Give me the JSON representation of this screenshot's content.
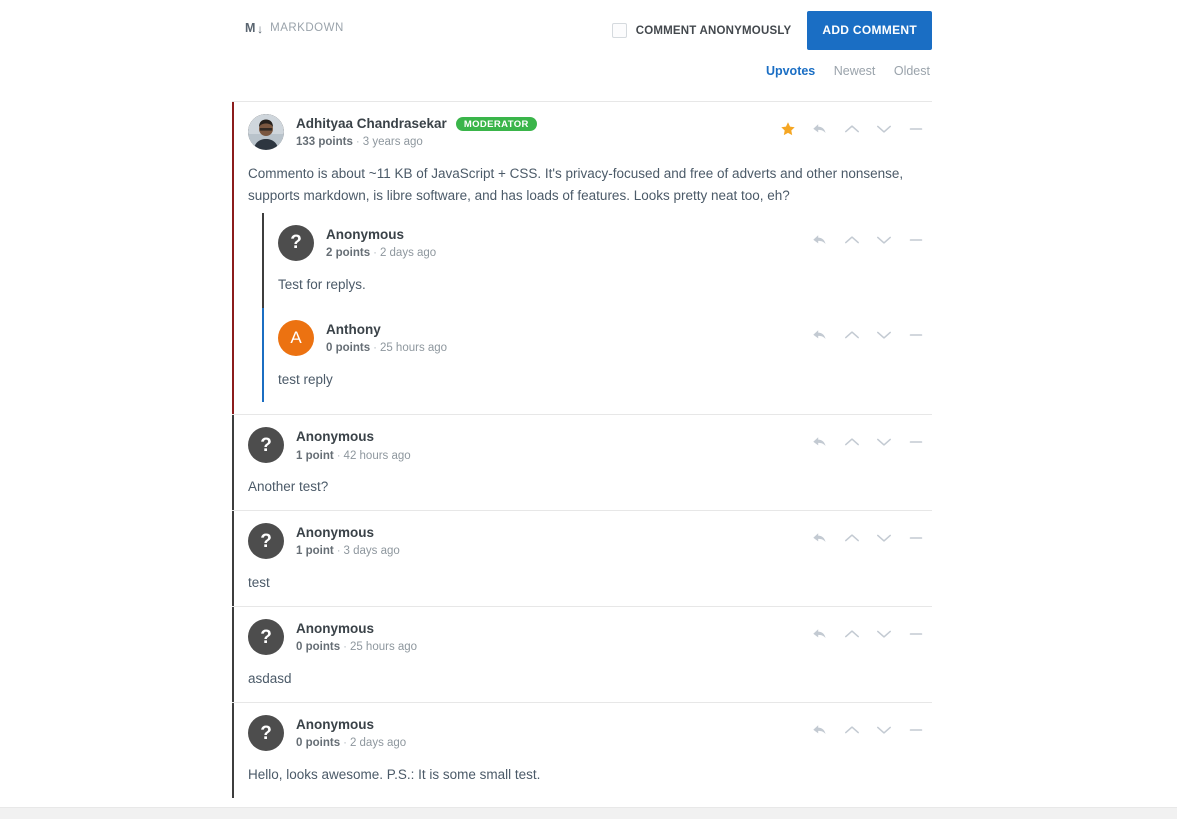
{
  "toolbar": {
    "markdown_glyph": "M",
    "markdown_arrow": "↓",
    "markdown_label": "MARKDOWN",
    "anonymous_label": "COMMENT ANONYMOUSLY",
    "anonymous_checked": false,
    "add_comment_label": "ADD COMMENT",
    "accent_color": "#1a6ec4"
  },
  "sort": {
    "options": [
      {
        "label": "Upvotes",
        "active": true
      },
      {
        "label": "Newest",
        "active": false
      },
      {
        "label": "Oldest",
        "active": false
      }
    ]
  },
  "comments": [
    {
      "author": "Adhityaa Chandrasekar",
      "badge": "MODERATOR",
      "points": "133 points",
      "separator": "·",
      "time": "3 years ago",
      "body": "Commento is about ~11 KB of JavaScript + CSS. It's privacy-focused and free of adverts and other nonsense, supports markdown, is libre software, and has loads of features. Looks pretty neat too, eh?",
      "avatar_type": "photo",
      "avatar_text": "",
      "avatar_color": "#4a4a4a",
      "border_color": "#8c1c1c",
      "starred": true,
      "actions": [
        "star-icon",
        "reply-icon",
        "upvote-icon",
        "downvote-icon",
        "collapse-icon"
      ],
      "replies": [
        {
          "author": "Anonymous",
          "badge": "",
          "points": "2 points",
          "separator": "·",
          "time": "2 days ago",
          "body": "Test for replys.",
          "avatar_type": "anon",
          "avatar_text": "?",
          "avatar_color": "#4d4d4d",
          "border_color": "#3d3d3d",
          "starred": false,
          "actions": [
            "reply-icon",
            "upvote-icon",
            "downvote-icon",
            "collapse-icon"
          ],
          "replies": []
        },
        {
          "author": "Anthony",
          "badge": "",
          "points": "0 points",
          "separator": "·",
          "time": "25 hours ago",
          "body": "test reply",
          "avatar_type": "letter",
          "avatar_text": "A",
          "avatar_color": "#ec7211",
          "border_color": "#1b6ec2",
          "starred": false,
          "actions": [
            "reply-icon",
            "upvote-icon",
            "downvote-icon",
            "collapse-icon"
          ],
          "replies": []
        }
      ]
    },
    {
      "author": "Anonymous",
      "badge": "",
      "points": "1 point",
      "separator": "·",
      "time": "42 hours ago",
      "body": "Another test?",
      "avatar_type": "anon",
      "avatar_text": "?",
      "avatar_color": "#4d4d4d",
      "border_color": "#3d3d3d",
      "starred": false,
      "actions": [
        "reply-icon",
        "upvote-icon",
        "downvote-icon",
        "collapse-icon"
      ],
      "replies": []
    },
    {
      "author": "Anonymous",
      "badge": "",
      "points": "1 point",
      "separator": "·",
      "time": "3 days ago",
      "body": "test",
      "avatar_type": "anon",
      "avatar_text": "?",
      "avatar_color": "#4d4d4d",
      "border_color": "#3d3d3d",
      "starred": false,
      "actions": [
        "reply-icon",
        "upvote-icon",
        "downvote-icon",
        "collapse-icon"
      ],
      "replies": []
    },
    {
      "author": "Anonymous",
      "badge": "",
      "points": "0 points",
      "separator": "·",
      "time": "25 hours ago",
      "body": "asdasd",
      "avatar_type": "anon",
      "avatar_text": "?",
      "avatar_color": "#4d4d4d",
      "border_color": "#3d3d3d",
      "starred": false,
      "actions": [
        "reply-icon",
        "upvote-icon",
        "downvote-icon",
        "collapse-icon"
      ],
      "replies": []
    },
    {
      "author": "Anonymous",
      "badge": "",
      "points": "0 points",
      "separator": "·",
      "time": "2 days ago",
      "body": "Hello, looks awesome. P.S.: It is some small test.",
      "avatar_type": "anon",
      "avatar_text": "?",
      "avatar_color": "#4d4d4d",
      "border_color": "#3d3d3d",
      "starred": false,
      "actions": [
        "reply-icon",
        "upvote-icon",
        "downvote-icon",
        "collapse-icon"
      ],
      "replies": []
    }
  ]
}
